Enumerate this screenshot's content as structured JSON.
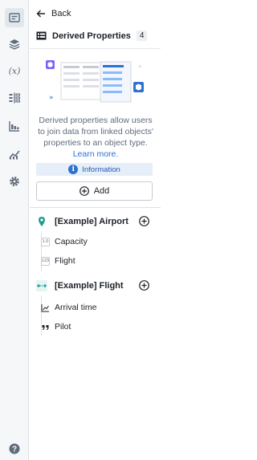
{
  "nav": {
    "back_label": "Back",
    "rail_items": [
      {
        "icon": "properties-panel-icon"
      },
      {
        "icon": "layers-icon"
      },
      {
        "icon": "variable-icon",
        "text": "(x)"
      },
      {
        "icon": "split-columns-icon"
      },
      {
        "icon": "timeseries-chart-icon"
      },
      {
        "icon": "trend-chart-icon"
      },
      {
        "icon": "gear-icon"
      }
    ],
    "help_icon": "help-icon"
  },
  "header": {
    "title": "Derived Properties",
    "count": "4"
  },
  "intro": {
    "description": "Derived properties allow users to join data from linked objects' properties to an object type.",
    "learn_more": "Learn more.",
    "info_label": "Information",
    "add_label": "Add"
  },
  "groups": [
    {
      "title": "[Example] Airport",
      "icon": "map-pin-icon",
      "color": "#1c9b8f",
      "properties": [
        {
          "label": "Capacity",
          "icon_text": "1.0"
        },
        {
          "label": "Flight",
          "icon_text": "123"
        }
      ]
    },
    {
      "title": "[Example] Flight",
      "icon": "route-icon",
      "color": "#1c9b8f",
      "properties": [
        {
          "label": "Arrival time",
          "icon": "line-chart-icon"
        },
        {
          "label": "Pilot",
          "icon": "quote-icon"
        }
      ]
    }
  ],
  "colors": {
    "accent": "#2d72d2",
    "purple": "#7b61ff",
    "teal": "#1c9b8f"
  }
}
